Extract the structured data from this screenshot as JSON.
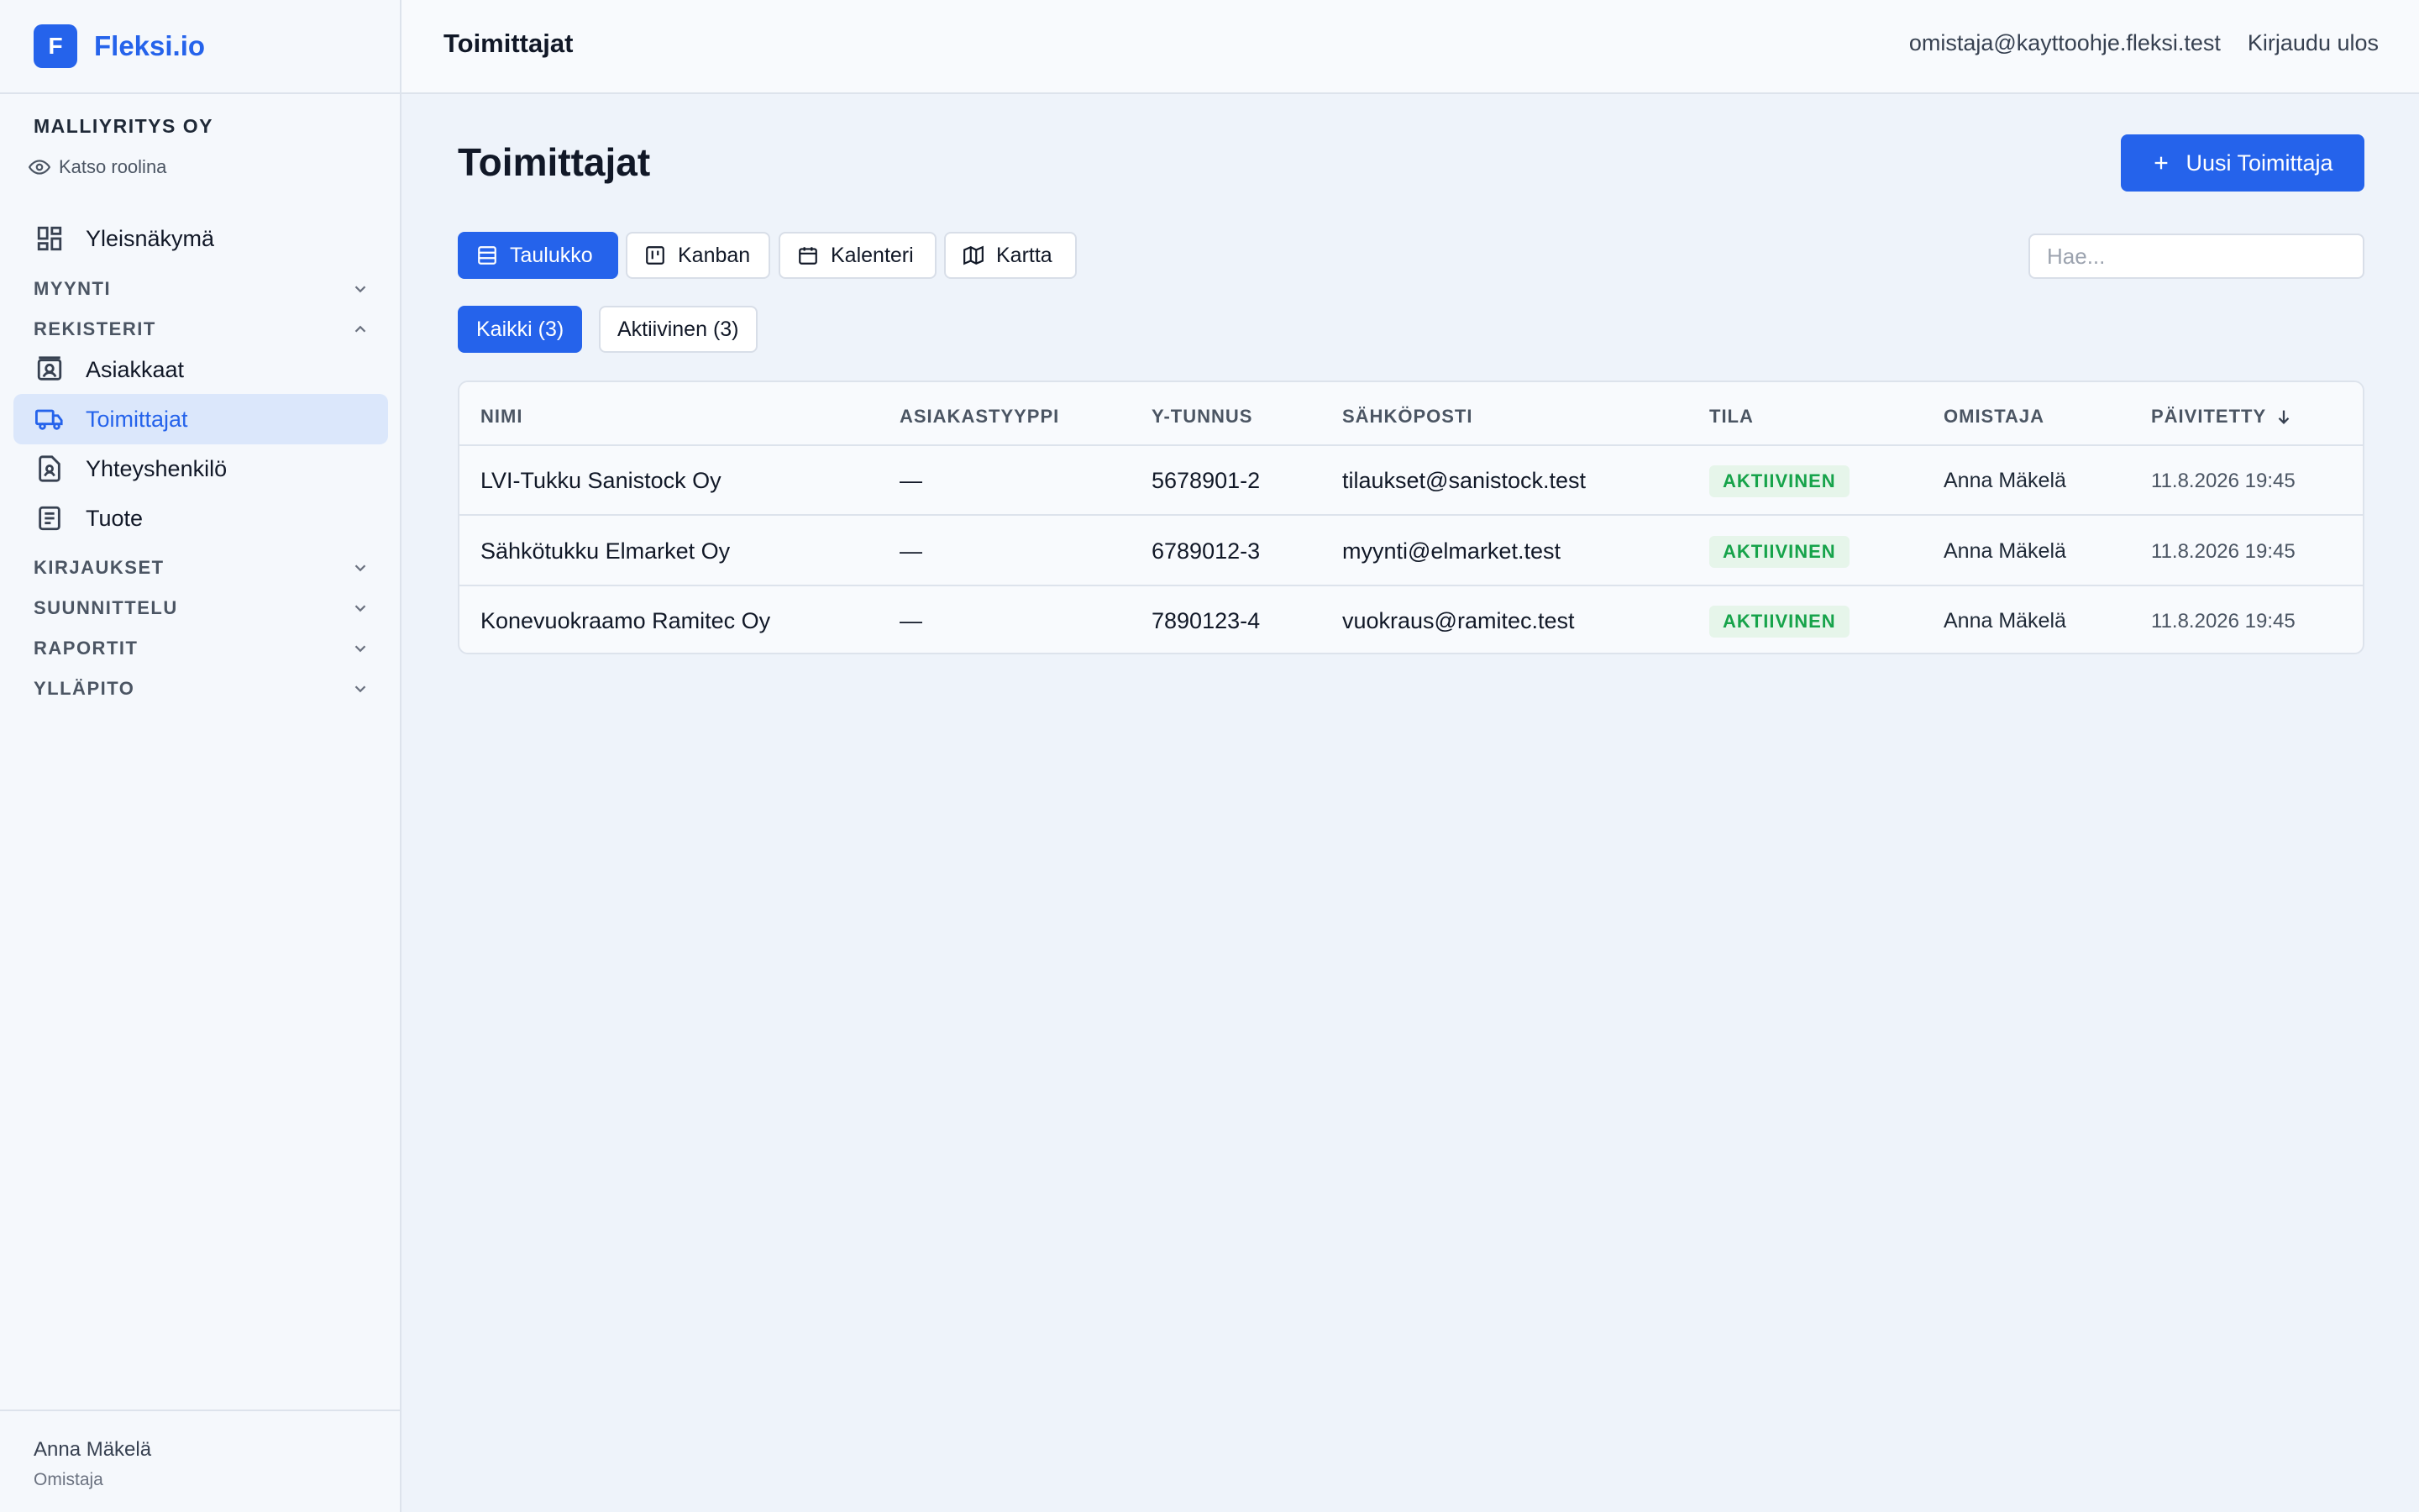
{
  "brand": {
    "logo_letter": "F",
    "name": "Fleksi.io"
  },
  "org": {
    "name": "MALLIYRITYS OY",
    "view_as_label": "Katso roolina"
  },
  "nav": {
    "overview": "Yleisnäkymä",
    "sections": {
      "sales": "MYYNTI",
      "registers": "REKISTERIT",
      "entries": "KIRJAUKSET",
      "planning": "SUUNNITTELU",
      "reports": "RAPORTIT",
      "admin": "YLLÄPITO"
    },
    "register_items": {
      "customers": "Asiakkaat",
      "suppliers": "Toimittajat",
      "contacts": "Yhteyshenkilö",
      "products": "Tuote"
    }
  },
  "user": {
    "name": "Anna Mäkelä",
    "role": "Omistaja"
  },
  "topbar": {
    "title": "Toimittajat",
    "email": "omistaja@kayttoohje.fleksi.test",
    "logout": "Kirjaudu ulos"
  },
  "page": {
    "title": "Toimittajat",
    "new_button": "Uusi Toimittaja",
    "search_placeholder": "Hae..."
  },
  "views": {
    "table": "Taulukko",
    "kanban": "Kanban",
    "calendar": "Kalenteri",
    "map": "Kartta"
  },
  "filters": {
    "all": "Kaikki (3)",
    "active": "Aktiivinen (3)"
  },
  "table": {
    "columns": {
      "name": "NIMI",
      "customer_type": "ASIAKASTYYPPI",
      "business_id": "Y-TUNNUS",
      "email": "SÄHKÖPOSTI",
      "status": "TILA",
      "owner": "OMISTAJA",
      "updated": "PÄIVITETTY"
    },
    "rows": [
      {
        "name": "LVI-Tukku Sanistock Oy",
        "customer_type": "—",
        "business_id": "5678901-2",
        "email": "tilaukset@sanistock.test",
        "status": "AKTIIVINEN",
        "owner": "Anna Mäkelä",
        "updated": "11.8.2026 19:45"
      },
      {
        "name": "Sähkötukku Elmarket Oy",
        "customer_type": "—",
        "business_id": "6789012-3",
        "email": "myynti@elmarket.test",
        "status": "AKTIIVINEN",
        "owner": "Anna Mäkelä",
        "updated": "11.8.2026 19:45"
      },
      {
        "name": "Konevuokraamo Ramitec Oy",
        "customer_type": "—",
        "business_id": "7890123-4",
        "email": "vuokraus@ramitec.test",
        "status": "AKTIIVINEN",
        "owner": "Anna Mäkelä",
        "updated": "11.8.2026 19:45"
      }
    ]
  },
  "colors": {
    "accent": "#2563eb",
    "active_nav_bg": "#dbe7fb",
    "status_green": "#16a34a",
    "status_green_bg": "#e6f5ea"
  }
}
